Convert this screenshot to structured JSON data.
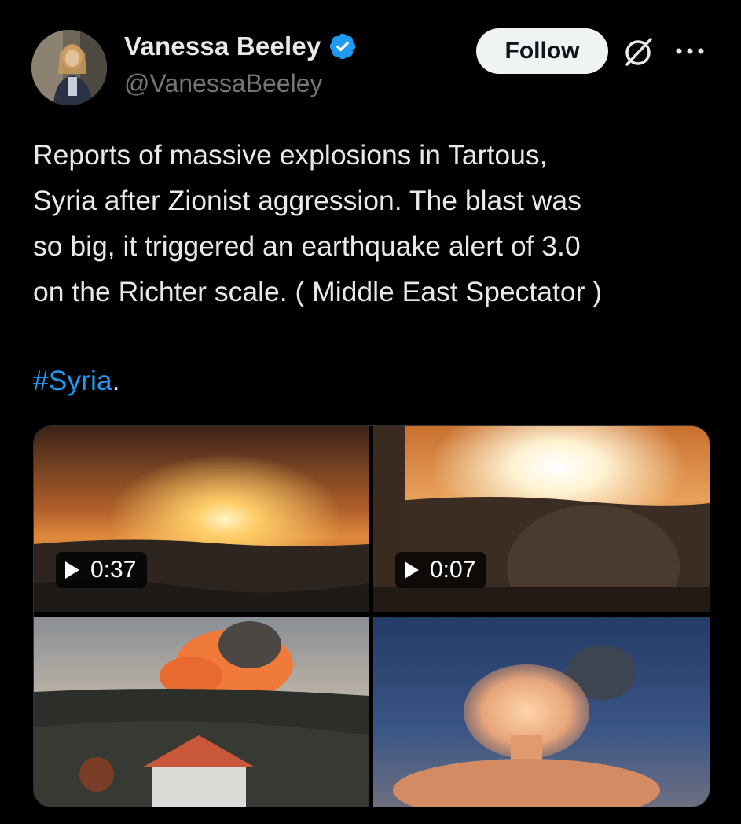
{
  "author": {
    "display_name": "Vanessa Beeley",
    "handle": "@VanessaBeeley",
    "verified_icon": "verified-badge-icon",
    "verified_color": "#1d9bf0"
  },
  "header": {
    "follow_label": "Follow",
    "grok_icon": "grok-icon",
    "more_icon": "more-dots-icon"
  },
  "tweet": {
    "text": "Reports of massive explosions in Tartous,\nSyria after Zionist aggression. The blast was\nso big, it  triggered an earthquake alert of 3.0\non the Richter scale.  ( Middle East Spectator )",
    "hashtag": "#Syria",
    "hashtag_suffix": "."
  },
  "media": {
    "items": [
      {
        "type": "video",
        "duration": "0:37"
      },
      {
        "type": "video",
        "duration": "0:07"
      },
      {
        "type": "image"
      },
      {
        "type": "image"
      }
    ]
  },
  "colors": {
    "background": "#000000",
    "text": "#e7e9ea",
    "secondary": "#71767b",
    "link": "#1d9bf0",
    "follow_bg": "#eff3f4"
  }
}
